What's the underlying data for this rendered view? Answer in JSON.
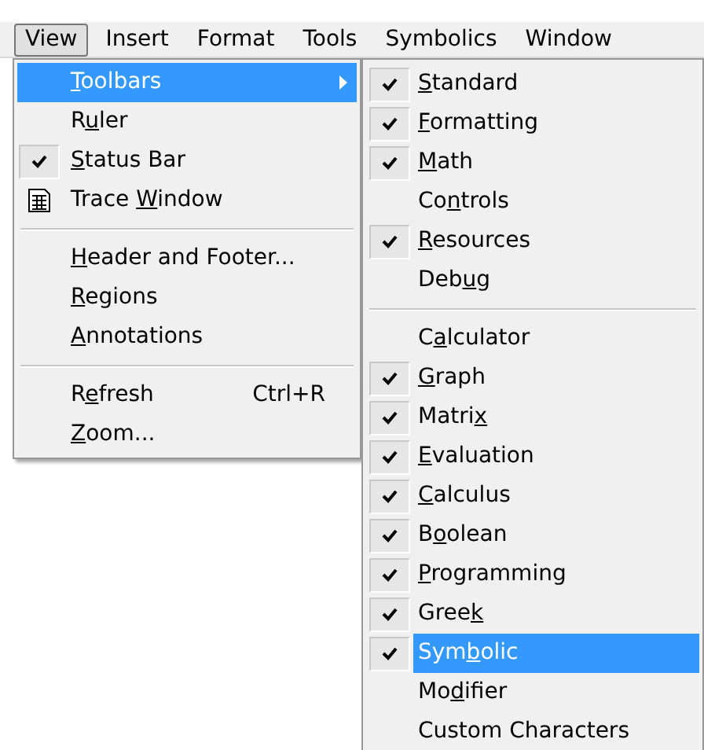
{
  "menu_bar": [
    {
      "label": "View",
      "selected": true
    },
    {
      "label": "Insert",
      "selected": false
    },
    {
      "label": "Format",
      "selected": false
    },
    {
      "label": "Tools",
      "selected": false
    },
    {
      "label": "Symbolics",
      "selected": false
    },
    {
      "label": "Window",
      "selected": false
    }
  ],
  "view_menu": [
    {
      "kind": "item",
      "label": {
        "key": "T",
        "post": "oolbars"
      },
      "selected": true,
      "submenu": true,
      "checked": false
    },
    {
      "kind": "item",
      "label": {
        "pre": "R",
        "key": "u",
        "post": "ler"
      },
      "selected": false,
      "checked": false
    },
    {
      "kind": "item",
      "label": {
        "key": "S",
        "post": "tatus Bar"
      },
      "selected": false,
      "checked": true
    },
    {
      "kind": "icon_item",
      "label": {
        "pre": "Trace ",
        "key": "W",
        "post": "indow"
      },
      "selected": false
    },
    {
      "kind": "separator"
    },
    {
      "kind": "item",
      "label": {
        "key": "H",
        "post": "eader and Footer..."
      },
      "selected": false,
      "checked": false
    },
    {
      "kind": "item",
      "label": {
        "key": "R",
        "post": "egions"
      },
      "selected": false,
      "checked": false
    },
    {
      "kind": "item",
      "label": {
        "key": "A",
        "post": "nnotations"
      },
      "selected": false,
      "checked": false
    },
    {
      "kind": "separator"
    },
    {
      "kind": "item",
      "label": {
        "pre": "R",
        "key": "e",
        "post": "fresh"
      },
      "shortcut": "Ctrl+R",
      "selected": false,
      "checked": false
    },
    {
      "kind": "item",
      "label": {
        "key": "Z",
        "post": "oom..."
      },
      "selected": false,
      "checked": false
    }
  ],
  "toolbars_submenu": [
    {
      "kind": "item",
      "label": {
        "key": "S",
        "post": "tandard"
      },
      "checked": true,
      "selected": false
    },
    {
      "kind": "item",
      "label": {
        "key": "F",
        "post": "ormatting"
      },
      "checked": true,
      "selected": false
    },
    {
      "kind": "item",
      "label": {
        "key": "M",
        "post": "ath"
      },
      "checked": true,
      "selected": false
    },
    {
      "kind": "item",
      "label": {
        "pre": "Co",
        "key": "n",
        "post": "trols"
      },
      "checked": false,
      "selected": false
    },
    {
      "kind": "item",
      "label": {
        "key": "R",
        "post": "esources"
      },
      "checked": true,
      "selected": false
    },
    {
      "kind": "item",
      "label": {
        "pre": "Deb",
        "key": "u",
        "post": "g"
      },
      "checked": false,
      "selected": false
    },
    {
      "kind": "separator"
    },
    {
      "kind": "item",
      "label": {
        "pre": "C",
        "key": "a",
        "post": "lculator"
      },
      "checked": false,
      "selected": false
    },
    {
      "kind": "item",
      "label": {
        "key": "G",
        "post": "raph"
      },
      "checked": true,
      "selected": false
    },
    {
      "kind": "item",
      "label": {
        "pre": "Matri",
        "key": "x"
      },
      "checked": true,
      "selected": false
    },
    {
      "kind": "item",
      "label": {
        "key": "E",
        "post": "valuation"
      },
      "checked": true,
      "selected": false
    },
    {
      "kind": "item",
      "label": {
        "key": "C",
        "post": "alculus"
      },
      "checked": true,
      "selected": false
    },
    {
      "kind": "item",
      "label": {
        "pre": "B",
        "key": "o",
        "post": "olean"
      },
      "checked": true,
      "selected": false
    },
    {
      "kind": "item",
      "label": {
        "key": "P",
        "post": "rogramming"
      },
      "checked": true,
      "selected": false
    },
    {
      "kind": "item",
      "label": {
        "pre": "Gree",
        "key": "k"
      },
      "checked": true,
      "selected": false
    },
    {
      "kind": "item",
      "label": {
        "pre": "Sym",
        "key": "b",
        "post": "olic"
      },
      "checked": true,
      "selected": true
    },
    {
      "kind": "item",
      "label": {
        "pre": "Mo",
        "key": "d",
        "post": "ifier"
      },
      "checked": false,
      "selected": false
    },
    {
      "kind": "item",
      "label": {
        "pre": "Custom Characters"
      },
      "checked": false,
      "selected": false
    }
  ]
}
